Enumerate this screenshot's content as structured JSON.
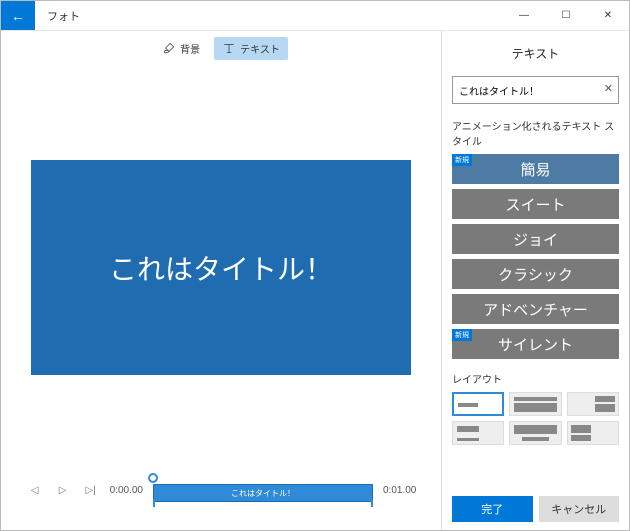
{
  "window": {
    "app_title": "フォト"
  },
  "toolbar": {
    "background_label": "背景",
    "text_label": "テキスト"
  },
  "canvas": {
    "title_text": "これはタイトル！"
  },
  "playback": {
    "start_time": "0:00.00",
    "end_time": "0:01.00",
    "clip_label": "これはタイトル！"
  },
  "side": {
    "panel_title": "テキスト",
    "input_value": "これはタイトル！",
    "styles_label": "アニメーション化されるテキスト スタイル",
    "new_badge": "新規",
    "styles": [
      {
        "label": "簡易",
        "selected": true,
        "new": true
      },
      {
        "label": "スイート",
        "selected": false,
        "new": false
      },
      {
        "label": "ジョイ",
        "selected": false,
        "new": false
      },
      {
        "label": "クラシック",
        "selected": false,
        "new": false
      },
      {
        "label": "アドベンチャー",
        "selected": false,
        "new": false
      },
      {
        "label": "サイレント",
        "selected": false,
        "new": true
      }
    ],
    "layout_label": "レイアウト",
    "done_label": "完了",
    "cancel_label": "キャンセル"
  }
}
